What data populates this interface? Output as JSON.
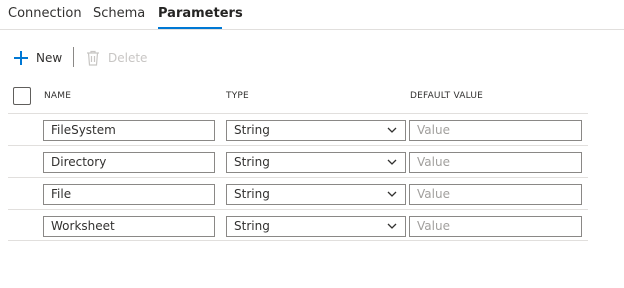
{
  "tabs": [
    {
      "label": "Connection"
    },
    {
      "label": "Schema"
    },
    {
      "label": "Parameters"
    }
  ],
  "toolbar": {
    "new_label": "New",
    "delete_label": "Delete"
  },
  "table": {
    "columns": [
      "NAME",
      "TYPE",
      "DEFAULT VALUE"
    ],
    "rows": [
      {
        "name": "FileSystem",
        "type": "String",
        "default_placeholder": "Value"
      },
      {
        "name": "Directory",
        "type": "String",
        "default_placeholder": "Value"
      },
      {
        "name": "File",
        "type": "String",
        "default_placeholder": "Value"
      },
      {
        "name": "Worksheet",
        "type": "String",
        "default_placeholder": "Value"
      }
    ]
  },
  "colors": {
    "accent": "#0078d4",
    "border": "#8a8886",
    "divider": "#e1dfdd",
    "disabled": "#c8c6c4"
  }
}
